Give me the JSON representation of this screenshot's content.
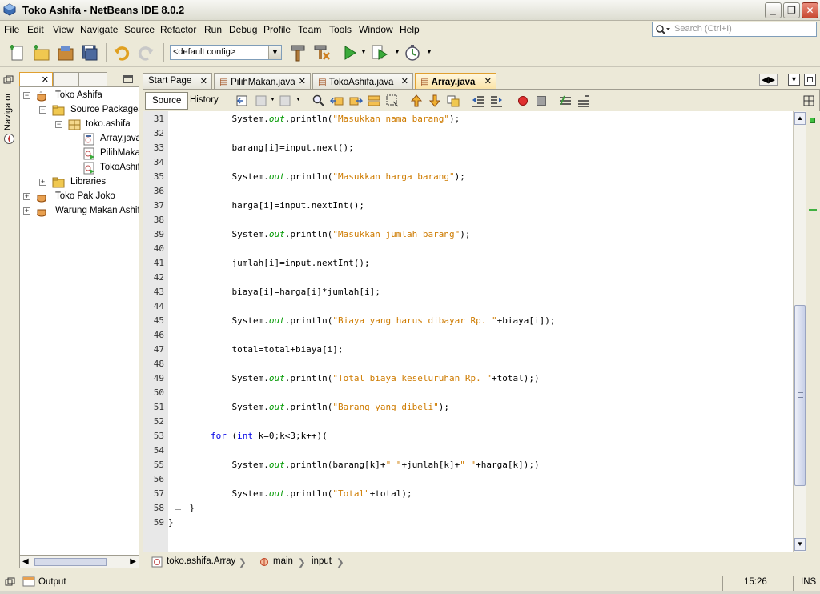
{
  "window": {
    "title": "Toko Ashifa - NetBeans IDE 8.0.2"
  },
  "menu": [
    "File",
    "Edit",
    "View",
    "Navigate",
    "Source",
    "Refactor",
    "Run",
    "Debug",
    "Profile",
    "Team",
    "Tools",
    "Window",
    "Help"
  ],
  "search": {
    "placeholder": "Search (Ctrl+I)"
  },
  "toolbar": {
    "config": "<default config>"
  },
  "navigator": {
    "label": "Navigator"
  },
  "projects": {
    "tree": [
      {
        "label": "Toko Ashifa",
        "icon": "coffee-cup-icon"
      },
      {
        "label": "Source Packages",
        "icon": "folder-icon"
      },
      {
        "label": "toko.ashifa",
        "icon": "package-icon"
      },
      {
        "label": "Array.java",
        "icon": "java-file-icon"
      },
      {
        "label": "PilihMakan.java",
        "icon": "java-main-file-icon"
      },
      {
        "label": "TokoAshifa.java",
        "icon": "java-main-file-icon"
      },
      {
        "label": "Libraries",
        "icon": "folder-icon"
      },
      {
        "label": "Toko Pak Joko",
        "icon": "coffee-cup-icon"
      },
      {
        "label": "Warung Makan Ashifa",
        "icon": "coffee-cup-icon"
      }
    ]
  },
  "editor": {
    "tabs": [
      {
        "label": "Start Page",
        "active": false
      },
      {
        "label": "PilihMakan.java",
        "active": false
      },
      {
        "label": "TokoAshifa.java",
        "active": false
      },
      {
        "label": "Array.java",
        "active": true
      }
    ],
    "source_label": "Source",
    "history_label": "History",
    "lines": [
      {
        "n": "31",
        "text": "            System.out.println(\"Masukkan nama barang\");"
      },
      {
        "n": "32",
        "text": ""
      },
      {
        "n": "33",
        "text": "            barang[i]=input.next();"
      },
      {
        "n": "34",
        "text": ""
      },
      {
        "n": "35",
        "text": "            System.out.println(\"Masukkan harga barang\");"
      },
      {
        "n": "36",
        "text": ""
      },
      {
        "n": "37",
        "text": "            harga[i]=input.nextInt();"
      },
      {
        "n": "38",
        "text": ""
      },
      {
        "n": "39",
        "text": "            System.out.println(\"Masukkan jumlah barang\");"
      },
      {
        "n": "40",
        "text": ""
      },
      {
        "n": "41",
        "text": "            jumlah[i]=input.nextInt();"
      },
      {
        "n": "42",
        "text": ""
      },
      {
        "n": "43",
        "text": "            biaya[i]=harga[i]*jumlah[i];"
      },
      {
        "n": "44",
        "text": ""
      },
      {
        "n": "45",
        "text": "            System.out.println(\"Biaya yang harus dibayar Rp. \"+biaya[i]);"
      },
      {
        "n": "46",
        "text": ""
      },
      {
        "n": "47",
        "text": "            total=total+biaya[i];"
      },
      {
        "n": "48",
        "text": ""
      },
      {
        "n": "49",
        "text": "            System.out.println(\"Total biaya keseluruhan Rp. \"+total);)"
      },
      {
        "n": "50",
        "text": ""
      },
      {
        "n": "51",
        "text": "            System.out.println(\"Barang yang dibeli\");"
      },
      {
        "n": "52",
        "text": ""
      },
      {
        "n": "53",
        "text": "        for (int k=0;k<3;k++)("
      },
      {
        "n": "54",
        "text": ""
      },
      {
        "n": "55",
        "text": "            System.out.println(barang[k]+\" \"+jumlah[k]+\" \"+harga[k]);)"
      },
      {
        "n": "56",
        "text": ""
      },
      {
        "n": "57",
        "text": "            System.out.println(\"Total\"+total);"
      },
      {
        "n": "58",
        "text": "    }"
      },
      {
        "n": "59",
        "text": "}"
      }
    ]
  },
  "breadcrumbs": [
    "toko.ashifa.Array",
    "main",
    "input"
  ],
  "status": {
    "output_label": "Output",
    "position": "15:26",
    "mode": "INS"
  }
}
